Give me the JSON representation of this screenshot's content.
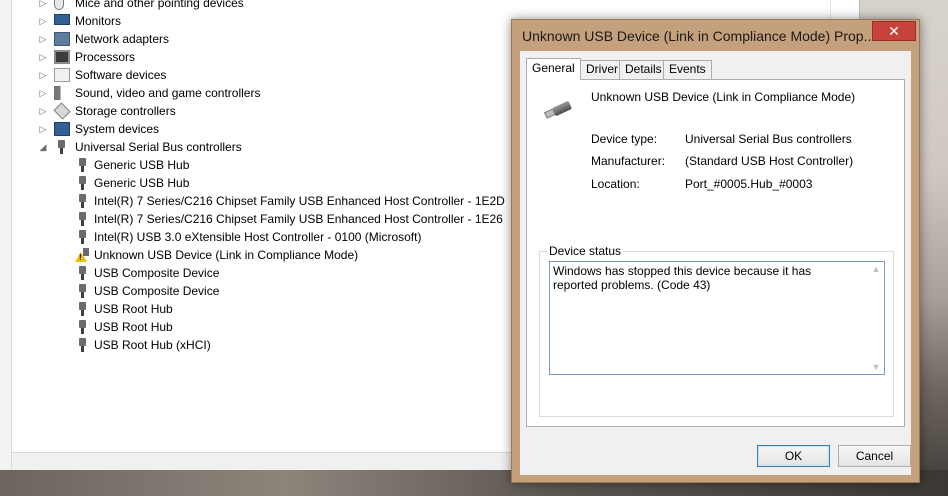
{
  "device_manager": {
    "tree": [
      {
        "label": "Mice and other pointing devices",
        "level": 0,
        "expanded": false,
        "icon": "mouse-icon"
      },
      {
        "label": "Monitors",
        "level": 0,
        "expanded": false,
        "icon": "monitor-icon"
      },
      {
        "label": "Network adapters",
        "level": 0,
        "expanded": false,
        "icon": "network-adapter-icon"
      },
      {
        "label": "Processors",
        "level": 0,
        "expanded": false,
        "icon": "processor-icon"
      },
      {
        "label": "Software devices",
        "level": 0,
        "expanded": false,
        "icon": "software-device-icon"
      },
      {
        "label": "Sound, video and game controllers",
        "level": 0,
        "expanded": false,
        "icon": "speaker-icon"
      },
      {
        "label": "Storage controllers",
        "level": 0,
        "expanded": false,
        "icon": "storage-controller-icon"
      },
      {
        "label": "System devices",
        "level": 0,
        "expanded": false,
        "icon": "system-device-icon"
      },
      {
        "label": "Universal Serial Bus controllers",
        "level": 0,
        "expanded": true,
        "icon": "usb-icon"
      },
      {
        "label": "Generic USB Hub",
        "level": 1,
        "icon": "usb-icon"
      },
      {
        "label": "Generic USB Hub",
        "level": 1,
        "icon": "usb-icon"
      },
      {
        "label": "Intel(R) 7 Series/C216 Chipset Family USB Enhanced Host Controller - 1E2D",
        "level": 1,
        "icon": "usb-icon"
      },
      {
        "label": "Intel(R) 7 Series/C216 Chipset Family USB Enhanced Host Controller - 1E26",
        "level": 1,
        "icon": "usb-icon"
      },
      {
        "label": "Intel(R) USB 3.0 eXtensible Host Controller - 0100 (Microsoft)",
        "level": 1,
        "icon": "usb-icon"
      },
      {
        "label": "Unknown USB Device (Link in Compliance Mode)",
        "level": 1,
        "icon": "warning-usb-icon"
      },
      {
        "label": "USB Composite Device",
        "level": 1,
        "icon": "usb-icon"
      },
      {
        "label": "USB Composite Device",
        "level": 1,
        "icon": "usb-icon"
      },
      {
        "label": "USB Root Hub",
        "level": 1,
        "icon": "usb-icon"
      },
      {
        "label": "USB Root Hub",
        "level": 1,
        "icon": "usb-icon"
      },
      {
        "label": "USB Root Hub (xHCI)",
        "level": 1,
        "icon": "usb-icon"
      }
    ]
  },
  "dialog": {
    "title": "Unknown USB Device (Link in Compliance Mode) Prop...",
    "close_label": "✕",
    "tabs": [
      "General",
      "Driver",
      "Details",
      "Events"
    ],
    "active_tab": "General",
    "device_name": "Unknown USB Device (Link in Compliance Mode)",
    "properties": [
      {
        "label": "Device type:",
        "value": "Universal Serial Bus controllers"
      },
      {
        "label": "Manufacturer:",
        "value": "(Standard USB Host Controller)"
      },
      {
        "label": "Location:",
        "value": "Port_#0005.Hub_#0003"
      }
    ],
    "status_legend": "Device status",
    "status_text": "Windows has stopped this device because it has reported problems. (Code 43)",
    "ok_label": "OK",
    "cancel_label": "Cancel"
  },
  "colors": {
    "dialog_frame": "#c5a07c",
    "close_button": "#c7423a",
    "warning": "#f2c200"
  }
}
